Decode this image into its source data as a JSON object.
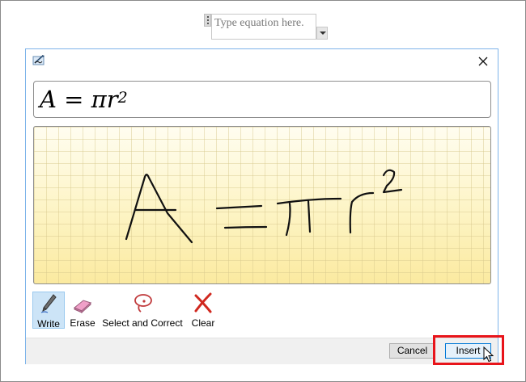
{
  "document": {
    "equation_placeholder": "Type equation here."
  },
  "dialog": {
    "preview_lhs": "A = πr",
    "preview_exponent": "2",
    "tools": [
      {
        "label": "Write",
        "icon": "pen-icon",
        "selected": true
      },
      {
        "label": "Erase",
        "icon": "eraser-icon",
        "selected": false
      },
      {
        "label": "Select and Correct",
        "icon": "lasso-icon",
        "selected": false
      },
      {
        "label": "Clear",
        "icon": "clear-x-icon",
        "selected": false
      }
    ],
    "cancel_label": "Cancel",
    "insert_label": "Insert"
  },
  "colors": {
    "highlight_frame": "#e8141a",
    "accent": "#0078d7",
    "canvas_bg": "#fdf6c8"
  }
}
